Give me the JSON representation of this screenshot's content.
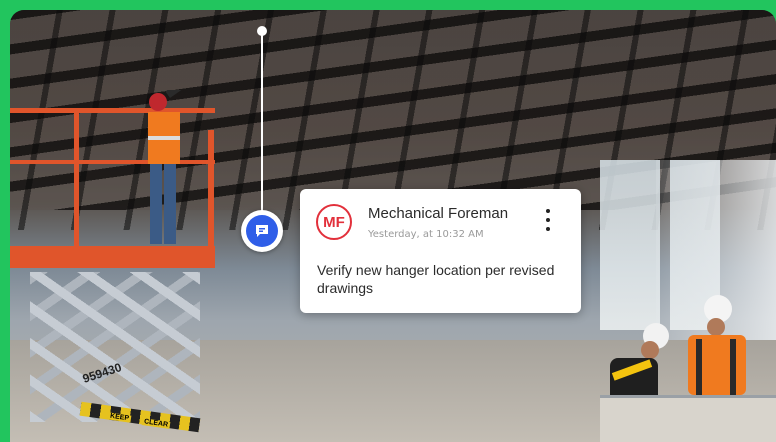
{
  "comment": {
    "avatar_initials": "MF",
    "author": "Mechanical Foreman",
    "timestamp": "Yesterday, at 10:32 AM",
    "message": "Verify new hanger location per revised drawings"
  },
  "lift": {
    "serial": "959430",
    "labels": [
      "KEEP",
      "CLEAR"
    ]
  },
  "colors": {
    "frame": "#22c55e",
    "pin_blue": "#2f5ee8",
    "avatar_red": "#e2303b"
  },
  "icons": {
    "pin": "comment-bubble-icon",
    "menu": "more-vertical-icon"
  }
}
